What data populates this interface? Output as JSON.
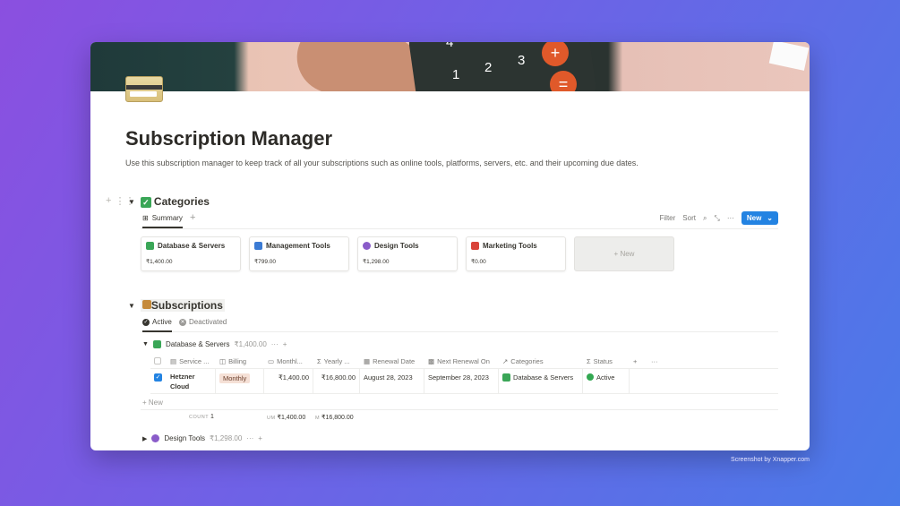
{
  "page": {
    "title": "Subscription Manager",
    "description": "Use this subscription manager to keep track of all your subscriptions such as online tools, platforms, servers, etc. and their upcoming due dates.",
    "credit": "Screenshot by Xnapper.com"
  },
  "cover": {
    "keys": [
      "4",
      "1",
      "2",
      "3",
      "+",
      "="
    ]
  },
  "categories": {
    "title": "Categories",
    "tab": "Summary",
    "toolbar": {
      "filter": "Filter",
      "sort": "Sort",
      "new": "New"
    },
    "cards": [
      {
        "name": "Database & Servers",
        "amount": "₹1,400.00",
        "icon": "database-icon",
        "color": "#3aa657"
      },
      {
        "name": "Management Tools",
        "amount": "₹799.00",
        "icon": "puzzle-icon",
        "color": "#3b7bd4"
      },
      {
        "name": "Design Tools",
        "amount": "₹1,298.00",
        "icon": "palette-icon",
        "color": "#8a5cc9"
      },
      {
        "name": "Marketing Tools",
        "amount": "₹0.00",
        "icon": "megaphone-icon",
        "color": "#d9443a"
      }
    ],
    "new_card": "+ New"
  },
  "subscriptions": {
    "title": "Subscriptions",
    "views": {
      "active": "Active",
      "deactivated": "Deactivated"
    },
    "group1": {
      "name": "Database & Servers",
      "amount": "₹1,400.00"
    },
    "columns": [
      "Service ...",
      "Billing",
      "Monthl...",
      "Yearly ...",
      "Renewal Date",
      "Next Renewal On",
      "Categories",
      "Status"
    ],
    "rows": [
      {
        "service": "Hetzner Cloud",
        "billing": "Monthly",
        "monthly": "₹1,400.00",
        "yearly": "₹16,800.00",
        "renewal": "August 28, 2023",
        "next": "September 28, 2023",
        "category": "Database & Servers",
        "status": "Active"
      }
    ],
    "new_row": "+ New",
    "calc": {
      "count_label": "COUNT",
      "count": "1",
      "um_label": "UM",
      "um": "₹1,400.00",
      "m_label": "M",
      "m": "₹16,800.00"
    },
    "group2": {
      "name": "Design Tools",
      "amount": "₹1,298.00"
    }
  }
}
